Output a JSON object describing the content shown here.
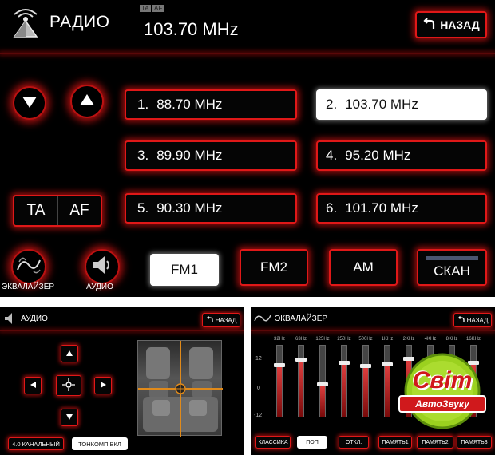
{
  "radio": {
    "title": "РАДИО",
    "ta_badge": "TA",
    "af_badge": "AF",
    "frequency": "103.70 MHz",
    "back_label": "НАЗАД",
    "presets": [
      {
        "num": "1.",
        "freq": "88.70 MHz"
      },
      {
        "num": "2.",
        "freq": "103.70 MHz"
      },
      {
        "num": "3.",
        "freq": "89.90 MHz"
      },
      {
        "num": "4.",
        "freq": "95.20 MHz"
      },
      {
        "num": "5.",
        "freq": "90.30 MHz"
      },
      {
        "num": "6.",
        "freq": "101.70 MHz"
      }
    ],
    "ta_label": "TA",
    "af_label": "AF",
    "bands": [
      "FM1",
      "FM2",
      "AM"
    ],
    "scan_label": "СКАН",
    "eq_label": "ЭКВАЛАЙЗЕР",
    "audio_label": "АУДИО"
  },
  "audio": {
    "title": "АУДИО",
    "back_label": "НАЗАД",
    "channel_label": "4.0 КАНАЛЬНЫЙ",
    "tone_label": "ТОНКОМП ВКЛ"
  },
  "eq": {
    "title": "ЭКВАЛАЙЗЕР",
    "back_label": "НАЗАД",
    "bands": [
      "32Hz",
      "63Hz",
      "125Hz",
      "250Hz",
      "500Hz",
      "1KHz",
      "2KHz",
      "4KHz",
      "8KHz",
      "16KHz"
    ],
    "levels": [
      0.42,
      0.58,
      -0.12,
      0.5,
      0.4,
      0.45,
      0.6,
      0.5,
      0.4,
      0.5
    ],
    "scale_top": "12",
    "scale_mid": "0",
    "scale_bottom": "-12",
    "presets": [
      "КЛАССИКА",
      "ПОП",
      "ОТКЛ.",
      "ПАМЯТЬ1",
      "ПАМЯТЬ2",
      "ПАМЯТЬ3"
    ]
  },
  "watermark": {
    "brand": "Світ",
    "sub": "АвтоЗвуку"
  },
  "colors": {
    "accent": "#e01818",
    "background": "#000000"
  }
}
